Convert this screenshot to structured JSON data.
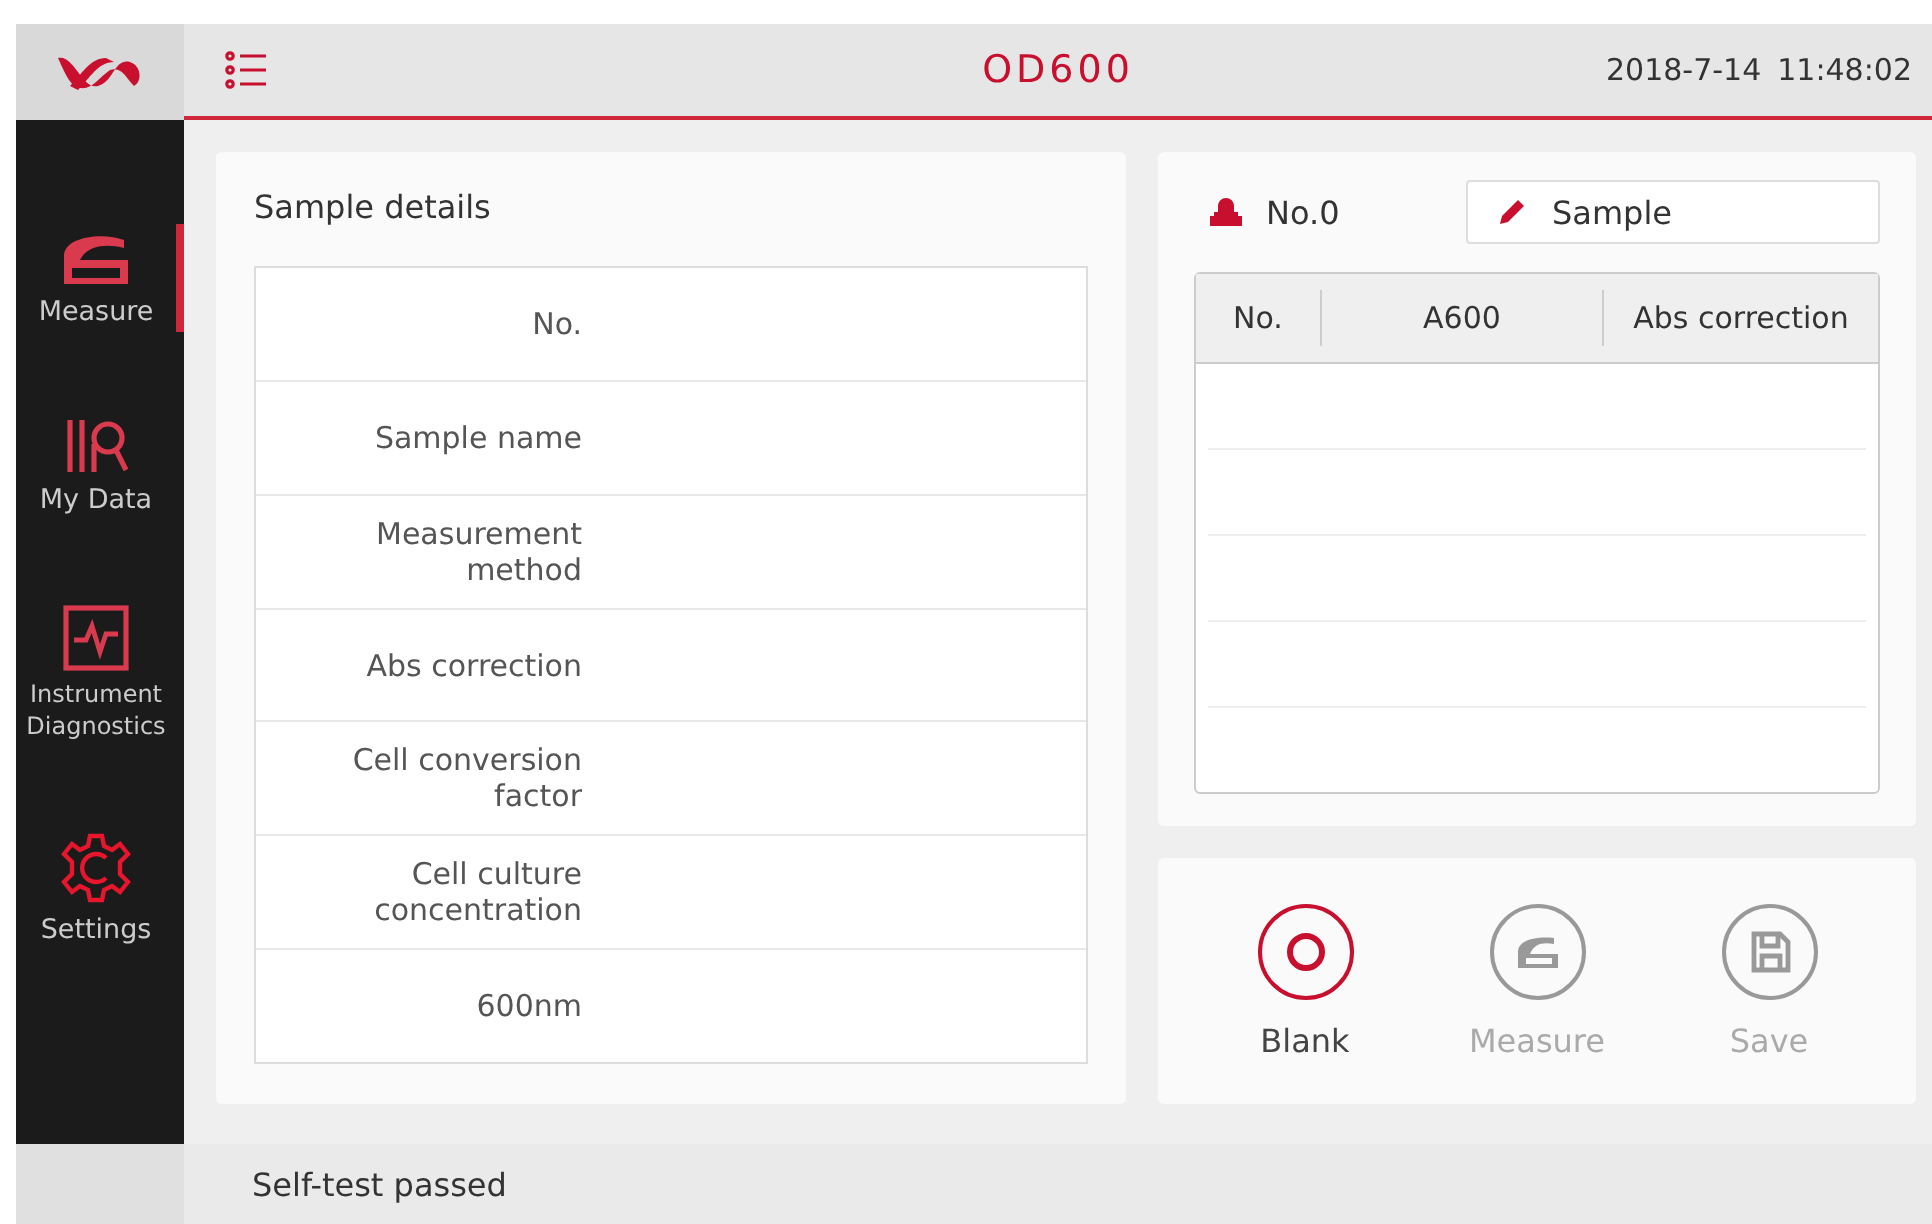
{
  "header": {
    "title": "OD600",
    "date": "2018-7-14",
    "time": "11:48:02"
  },
  "sidebar": {
    "items": [
      {
        "kind": "measure",
        "label": "Measure",
        "selected": true
      },
      {
        "kind": "data",
        "label": "My Data",
        "selected": false
      },
      {
        "kind": "diagnostics",
        "label": "Instrument Diagnostics",
        "selected": false
      },
      {
        "kind": "settings",
        "label": "Settings",
        "selected": false
      }
    ]
  },
  "sample_details": {
    "title": "Sample details",
    "rows": [
      {
        "label": "No."
      },
      {
        "label": "Sample name"
      },
      {
        "label": "Measurement method"
      },
      {
        "label": "Abs correction"
      },
      {
        "label": "Cell conversion factor"
      },
      {
        "label": "Cell culture concentration"
      },
      {
        "label": "600nm"
      }
    ]
  },
  "results": {
    "number": "No.0",
    "sample_field": "Sample",
    "columns": [
      "No.",
      "A600",
      "Abs correction"
    ]
  },
  "actions": [
    {
      "kind": "blank",
      "label": "Blank",
      "disabled": false
    },
    {
      "kind": "measure",
      "label": "Measure",
      "disabled": true
    },
    {
      "kind": "save",
      "label": "Save",
      "disabled": true
    }
  ],
  "status_bar": {
    "message": "Self-test passed"
  }
}
